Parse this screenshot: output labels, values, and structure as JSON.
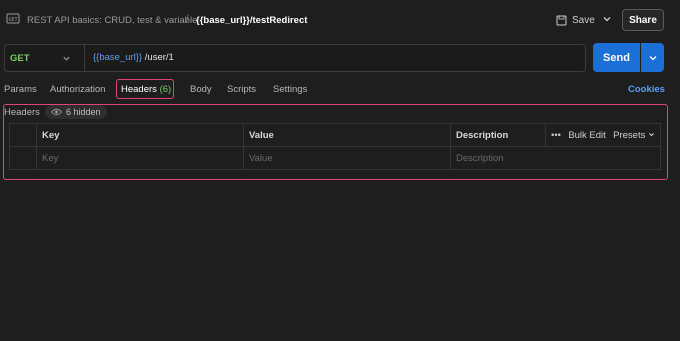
{
  "header": {
    "collection_name": "REST API basics: CRUD, test & variable",
    "separator": "/",
    "request_name": "{{base_url}}/testRedirect",
    "save_label": "Save",
    "share_label": "Share"
  },
  "request": {
    "method": "GET",
    "url_variable": "{{base_url}}",
    "url_path": " /user/1",
    "send_label": "Send"
  },
  "tabs": [
    {
      "label": "Params"
    },
    {
      "label": "Authorization"
    },
    {
      "label": "Headers",
      "count": "(6)",
      "active": true
    },
    {
      "label": "Body"
    },
    {
      "label": "Scripts"
    },
    {
      "label": "Settings"
    }
  ],
  "cookies_label": "Cookies",
  "headers_section": {
    "label": "Headers",
    "hidden_label": "6 hidden",
    "columns": {
      "key": "Key",
      "value": "Value",
      "description": "Description"
    },
    "more_label": "•••",
    "bulk_edit_label": "Bulk Edit",
    "presets_label": "Presets",
    "row_placeholders": {
      "key": "Key",
      "value": "Value",
      "description": "Description"
    }
  },
  "colors": {
    "accent_blue": "#1d6fd8",
    "method_green": "#7cc96b",
    "highlight_red": "#e0466d"
  }
}
